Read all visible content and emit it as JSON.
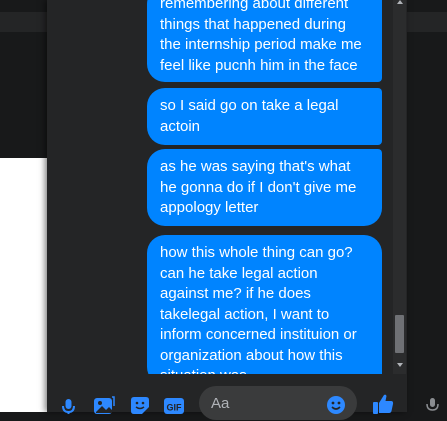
{
  "chat": {
    "messages": [
      {
        "text": "remembering about different things that happened during the internship period make me feel like pucnh him in the face"
      },
      {
        "text": "so I said go on take a legal actoin"
      },
      {
        "text": "as he was saying that's what he gonna do if I don't give me appology letter"
      },
      {
        "text": "how this whole thing can go? can he take legal action against me? if he does takelegal action, I  want to inform concerned instituion or organization about how this situation was…"
      }
    ],
    "bubble_color": "#0084ff"
  },
  "composer": {
    "placeholder": "Aa",
    "icons": [
      "microphone-icon",
      "image-icon",
      "sticker-icon",
      "gif-icon",
      "emoji-icon",
      "thumbs-up-icon"
    ]
  },
  "colors": {
    "panel": "#242526",
    "accent": "#2d88ff",
    "input_bg": "#3a3b3c"
  }
}
